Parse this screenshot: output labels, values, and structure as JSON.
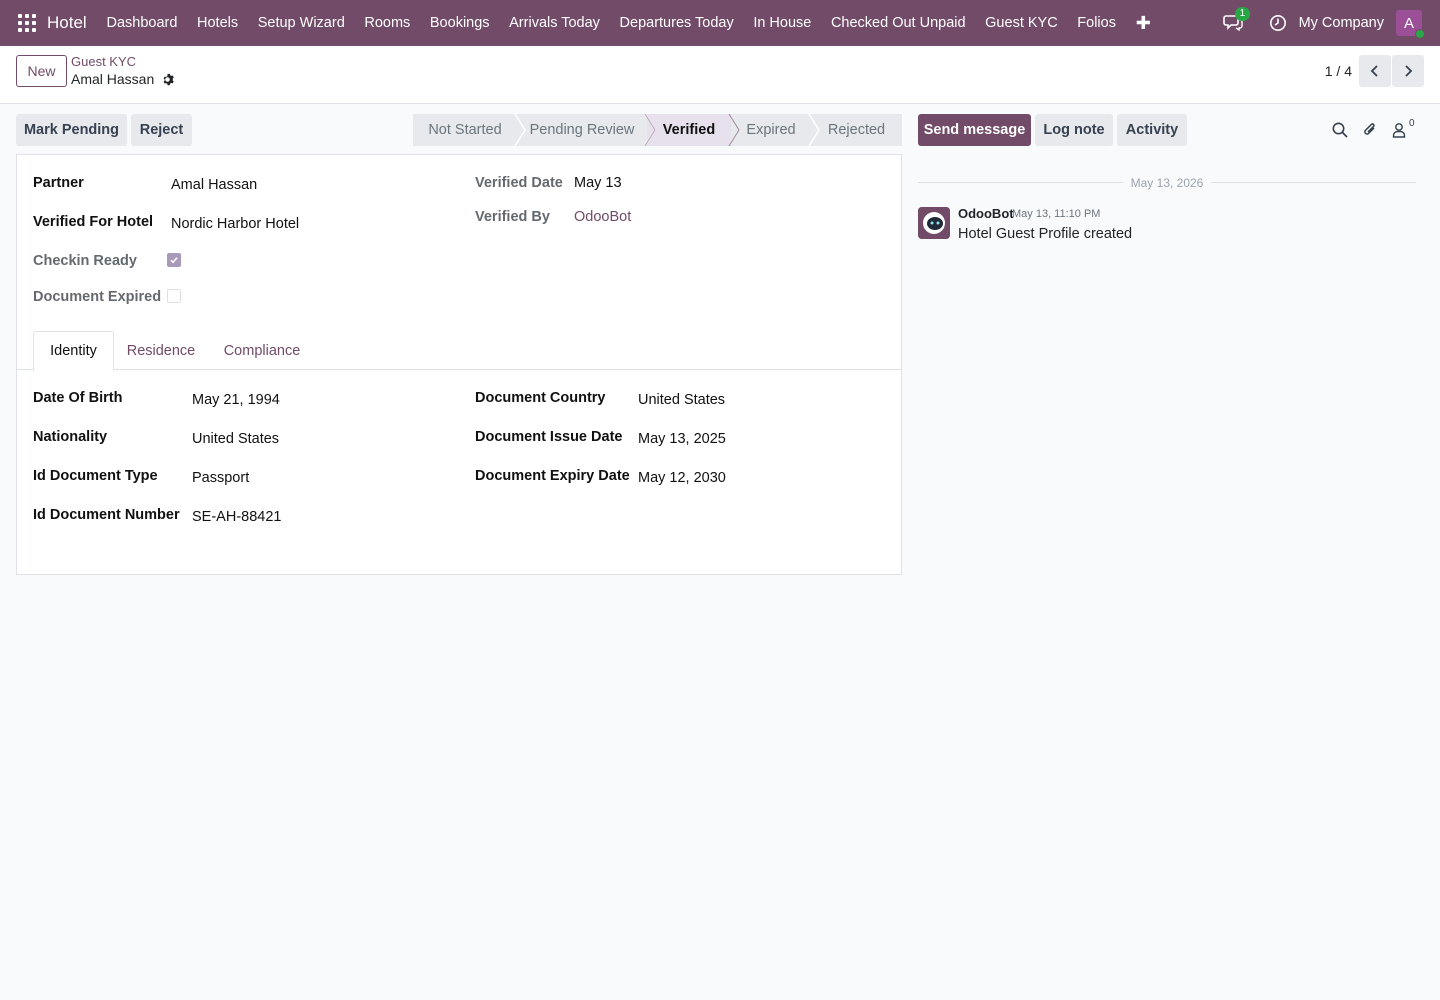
{
  "navbar": {
    "brand": "Hotel",
    "items": [
      "Dashboard",
      "Hotels",
      "Setup Wizard",
      "Rooms",
      "Bookings",
      "Arrivals Today",
      "Departures Today",
      "In House",
      "Checked Out Unpaid",
      "Guest KYC",
      "Folios"
    ],
    "chat_badge": "1",
    "company": "My Company",
    "avatar_letter": "A",
    "accent": "#714b67"
  },
  "control_panel": {
    "new_label": "New",
    "breadcrumb_parent": "Guest KYC",
    "breadcrumb_current": "Amal Hassan",
    "pager": "1 / 4"
  },
  "actions": {
    "mark_pending": "Mark Pending",
    "reject": "Reject"
  },
  "statusbar": {
    "stages": [
      "Not Started",
      "Pending Review",
      "Verified",
      "Expired",
      "Rejected"
    ],
    "active": "Verified"
  },
  "form": {
    "partner_label": "Partner",
    "partner_value": "Amal Hassan",
    "verified_hotel_label": "Verified For Hotel",
    "verified_hotel_value": "Nordic Harbor Hotel",
    "checkin_ready_label": "Checkin Ready",
    "checkin_ready": true,
    "document_expired_label": "Document Expired",
    "document_expired": false,
    "verified_date_label": "Verified Date",
    "verified_date_value": "May 13",
    "verified_by_label": "Verified By",
    "verified_by_value": "OdooBot"
  },
  "tabs": [
    "Identity",
    "Residence",
    "Compliance"
  ],
  "identity": {
    "dob_label": "Date Of Birth",
    "dob_value": "May 21, 1994",
    "nationality_label": "Nationality",
    "nationality_value": "United States",
    "doc_type_label": "Id Document Type",
    "doc_type_value": "Passport",
    "doc_number_label": "Id Document Number",
    "doc_number_value": "SE-AH-88421",
    "doc_country_label": "Document Country",
    "doc_country_value": "United States",
    "doc_issue_label": "Document Issue Date",
    "doc_issue_value": "May 13, 2025",
    "doc_expiry_label": "Document Expiry Date",
    "doc_expiry_value": "May 12, 2030"
  },
  "chatter": {
    "send_message": "Send message",
    "log_note": "Log note",
    "activity": "Activity",
    "followers_count": "0",
    "date_separator": "May 13, 2026",
    "message": {
      "author": "OdooBot",
      "time": "May 13, 11:10 PM",
      "body": "Hotel Guest Profile created"
    }
  }
}
